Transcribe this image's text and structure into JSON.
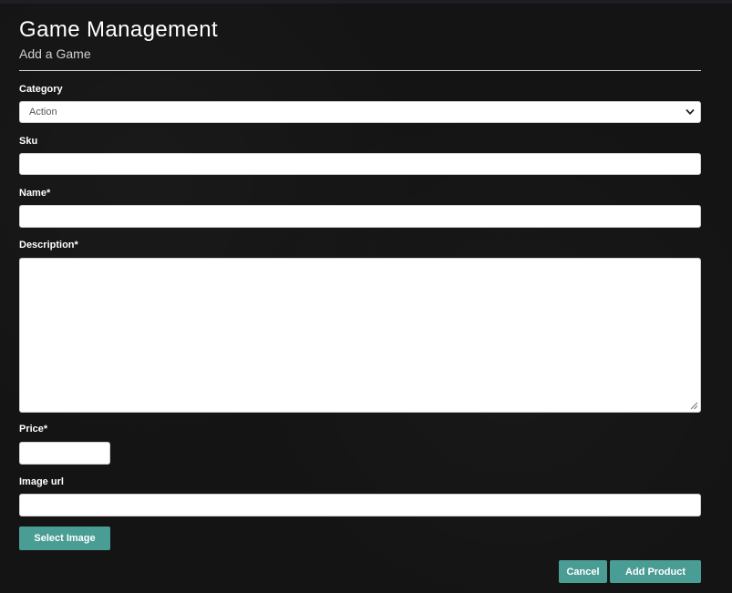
{
  "header": {
    "title": "Game Management",
    "subtitle": "Add a Game"
  },
  "form": {
    "category": {
      "label": "Category",
      "selected": "Action",
      "icon": "chevron-down-icon"
    },
    "sku": {
      "label": "Sku",
      "value": "",
      "placeholder": ""
    },
    "name": {
      "label": "Name*",
      "value": "",
      "placeholder": ""
    },
    "description": {
      "label": "Description*",
      "value": "",
      "placeholder": ""
    },
    "price": {
      "label": "Price*",
      "value": "",
      "placeholder": ""
    },
    "image_url": {
      "label": "Image url",
      "value": "",
      "placeholder": ""
    }
  },
  "actions": {
    "select_image": "Select Image",
    "cancel": "Cancel",
    "add_product": "Add Product"
  },
  "colors": {
    "background": "#141414",
    "accent": "#4a9d95",
    "input_bg": "#ffffff"
  }
}
